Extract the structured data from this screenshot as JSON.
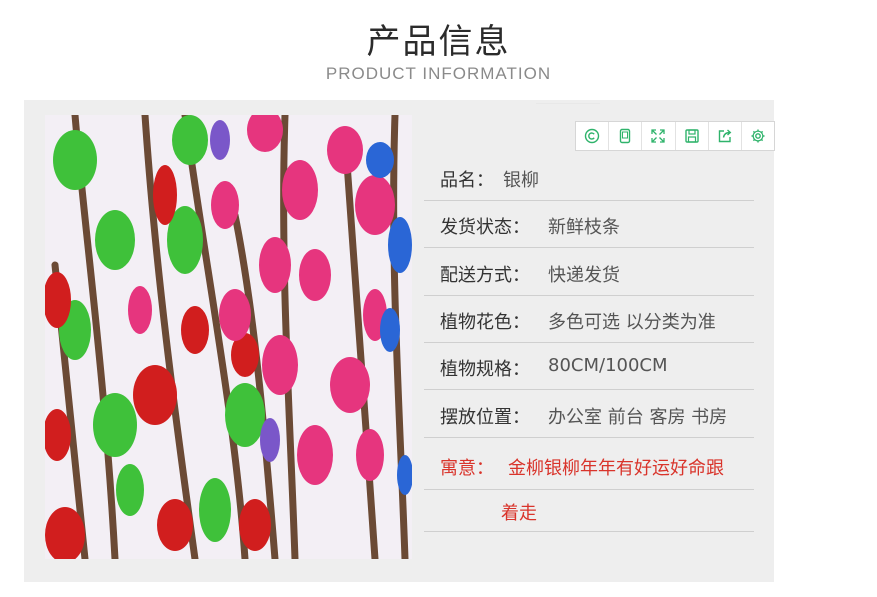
{
  "header": {
    "title": "产品信息",
    "subtitle": "PRODUCT INFORMATION"
  },
  "toolbar": {
    "icons": [
      "copyright-icon",
      "tablet-icon",
      "expand-icon",
      "save-icon",
      "share-icon",
      "settings-icon"
    ],
    "accent": "#2fb36b"
  },
  "info": {
    "name_label": "品名：",
    "name_value": "银柳",
    "shipping_label": "发货状态：",
    "shipping_value": "新鲜枝条",
    "delivery_label": "配送方式：",
    "delivery_value": "快递发货",
    "color_label": "植物花色：",
    "color_value": "多色可选 以分类为准",
    "spec_label": "植物规格：",
    "spec_value": "80CM/100CM",
    "place_label": "摆放位置：",
    "place_value": "办公室 前台 客房 书房",
    "meaning_label": "寓意：",
    "meaning_value": "金柳银柳年年有好运好命跟",
    "meaning_cont": "着走"
  },
  "colors": {
    "meaning_text": "#d9342b",
    "panel_bg": "#eeeeee"
  }
}
